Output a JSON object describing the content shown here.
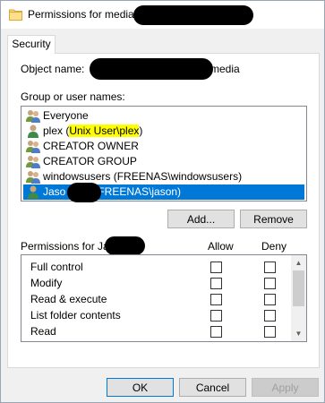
{
  "window": {
    "title": "Permissions for media ("
  },
  "tabs": [
    {
      "label": "Security"
    }
  ],
  "object": {
    "label": "Object name:",
    "value_suffix": "media"
  },
  "groups": {
    "label": "Group or user names:",
    "items": [
      {
        "name": "Everyone",
        "icon": "group-icon"
      },
      {
        "prefix": "plex (",
        "highlight": "Unix User\\plex",
        "suffix": ")",
        "icon": "user-icon"
      },
      {
        "name": "CREATOR OWNER",
        "icon": "group-icon"
      },
      {
        "name": "CREATOR GROUP",
        "icon": "group-icon"
      },
      {
        "name": "windowsusers (FREENAS\\windowsusers)",
        "icon": "group-icon"
      },
      {
        "prefix": "Jaso",
        "suffix": "(FREENAS\\jason)",
        "icon": "user-icon",
        "selected": true
      }
    ]
  },
  "buttons": {
    "add": "Add...",
    "remove": "Remove",
    "ok": "OK",
    "cancel": "Cancel",
    "apply": "Apply"
  },
  "permissions": {
    "label": "Permissions for Jaso",
    "allow_header": "Allow",
    "deny_header": "Deny",
    "rows": [
      {
        "name": "Full control",
        "allow": false,
        "deny": false
      },
      {
        "name": "Modify",
        "allow": false,
        "deny": false
      },
      {
        "name": "Read & execute",
        "allow": false,
        "deny": false
      },
      {
        "name": "List folder contents",
        "allow": false,
        "deny": false
      },
      {
        "name": "Read",
        "allow": false,
        "deny": false
      }
    ]
  },
  "colors": {
    "selection": "#0078d7",
    "highlight": "#ffff00"
  }
}
